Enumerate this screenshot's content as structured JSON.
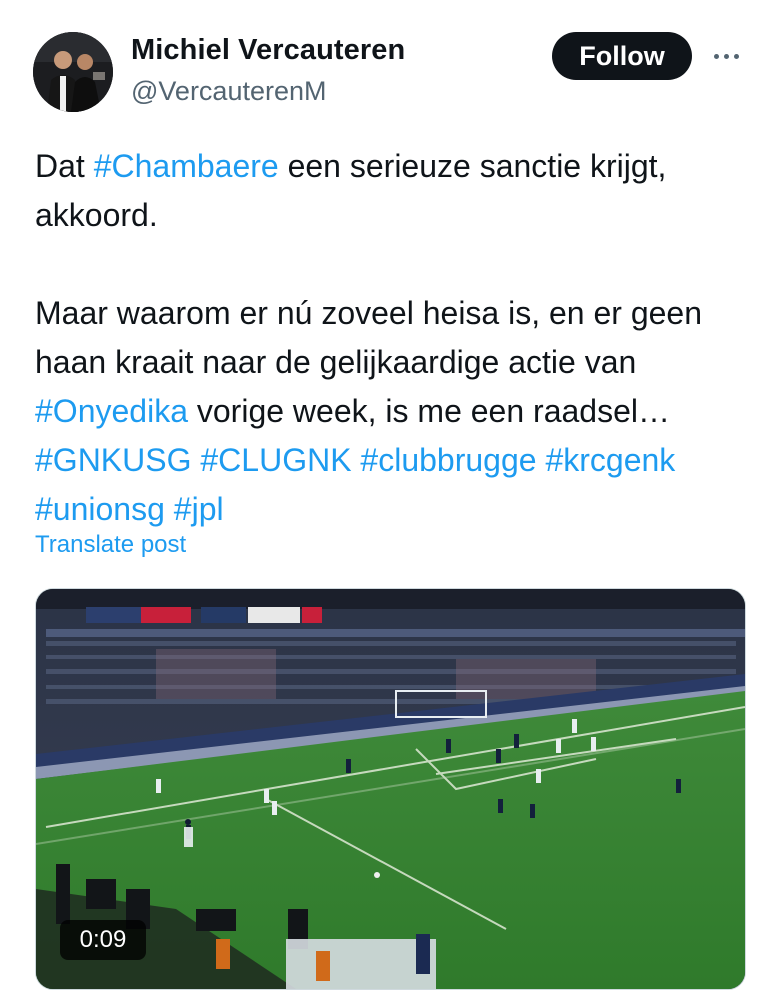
{
  "author": {
    "name": "Michiel Vercauteren",
    "handle": "@VercauterenM",
    "avatar_icon": "profile-photo"
  },
  "actions": {
    "follow_label": "Follow",
    "more_icon": "more-horizontal-icon"
  },
  "tweet": {
    "p1": {
      "w1": "Dat",
      "tag1": "#Chambaere",
      "w2": "een serieuze sanctie krijgt, akkoord."
    },
    "p2": {
      "w1": "Maar waarom er nú zoveel heisa is, en er geen haan kraait naar de gelijkaardige actie van",
      "tag1": "#Onyedika",
      "w2": "vorige week, is me een raadsel…",
      "tags": [
        "#GNKUSG",
        "#CLUGNK",
        "#clubbrugge",
        "#krcgenk",
        "#unionsg",
        "#jpl"
      ]
    },
    "translate_label": "Translate post"
  },
  "video": {
    "duration": "0:09",
    "description_icon": "video-thumbnail-football-match"
  },
  "colors": {
    "link": "#1d9bf0",
    "text": "#0f1419",
    "secondary": "#536471",
    "follow_bg": "#0f1419"
  }
}
